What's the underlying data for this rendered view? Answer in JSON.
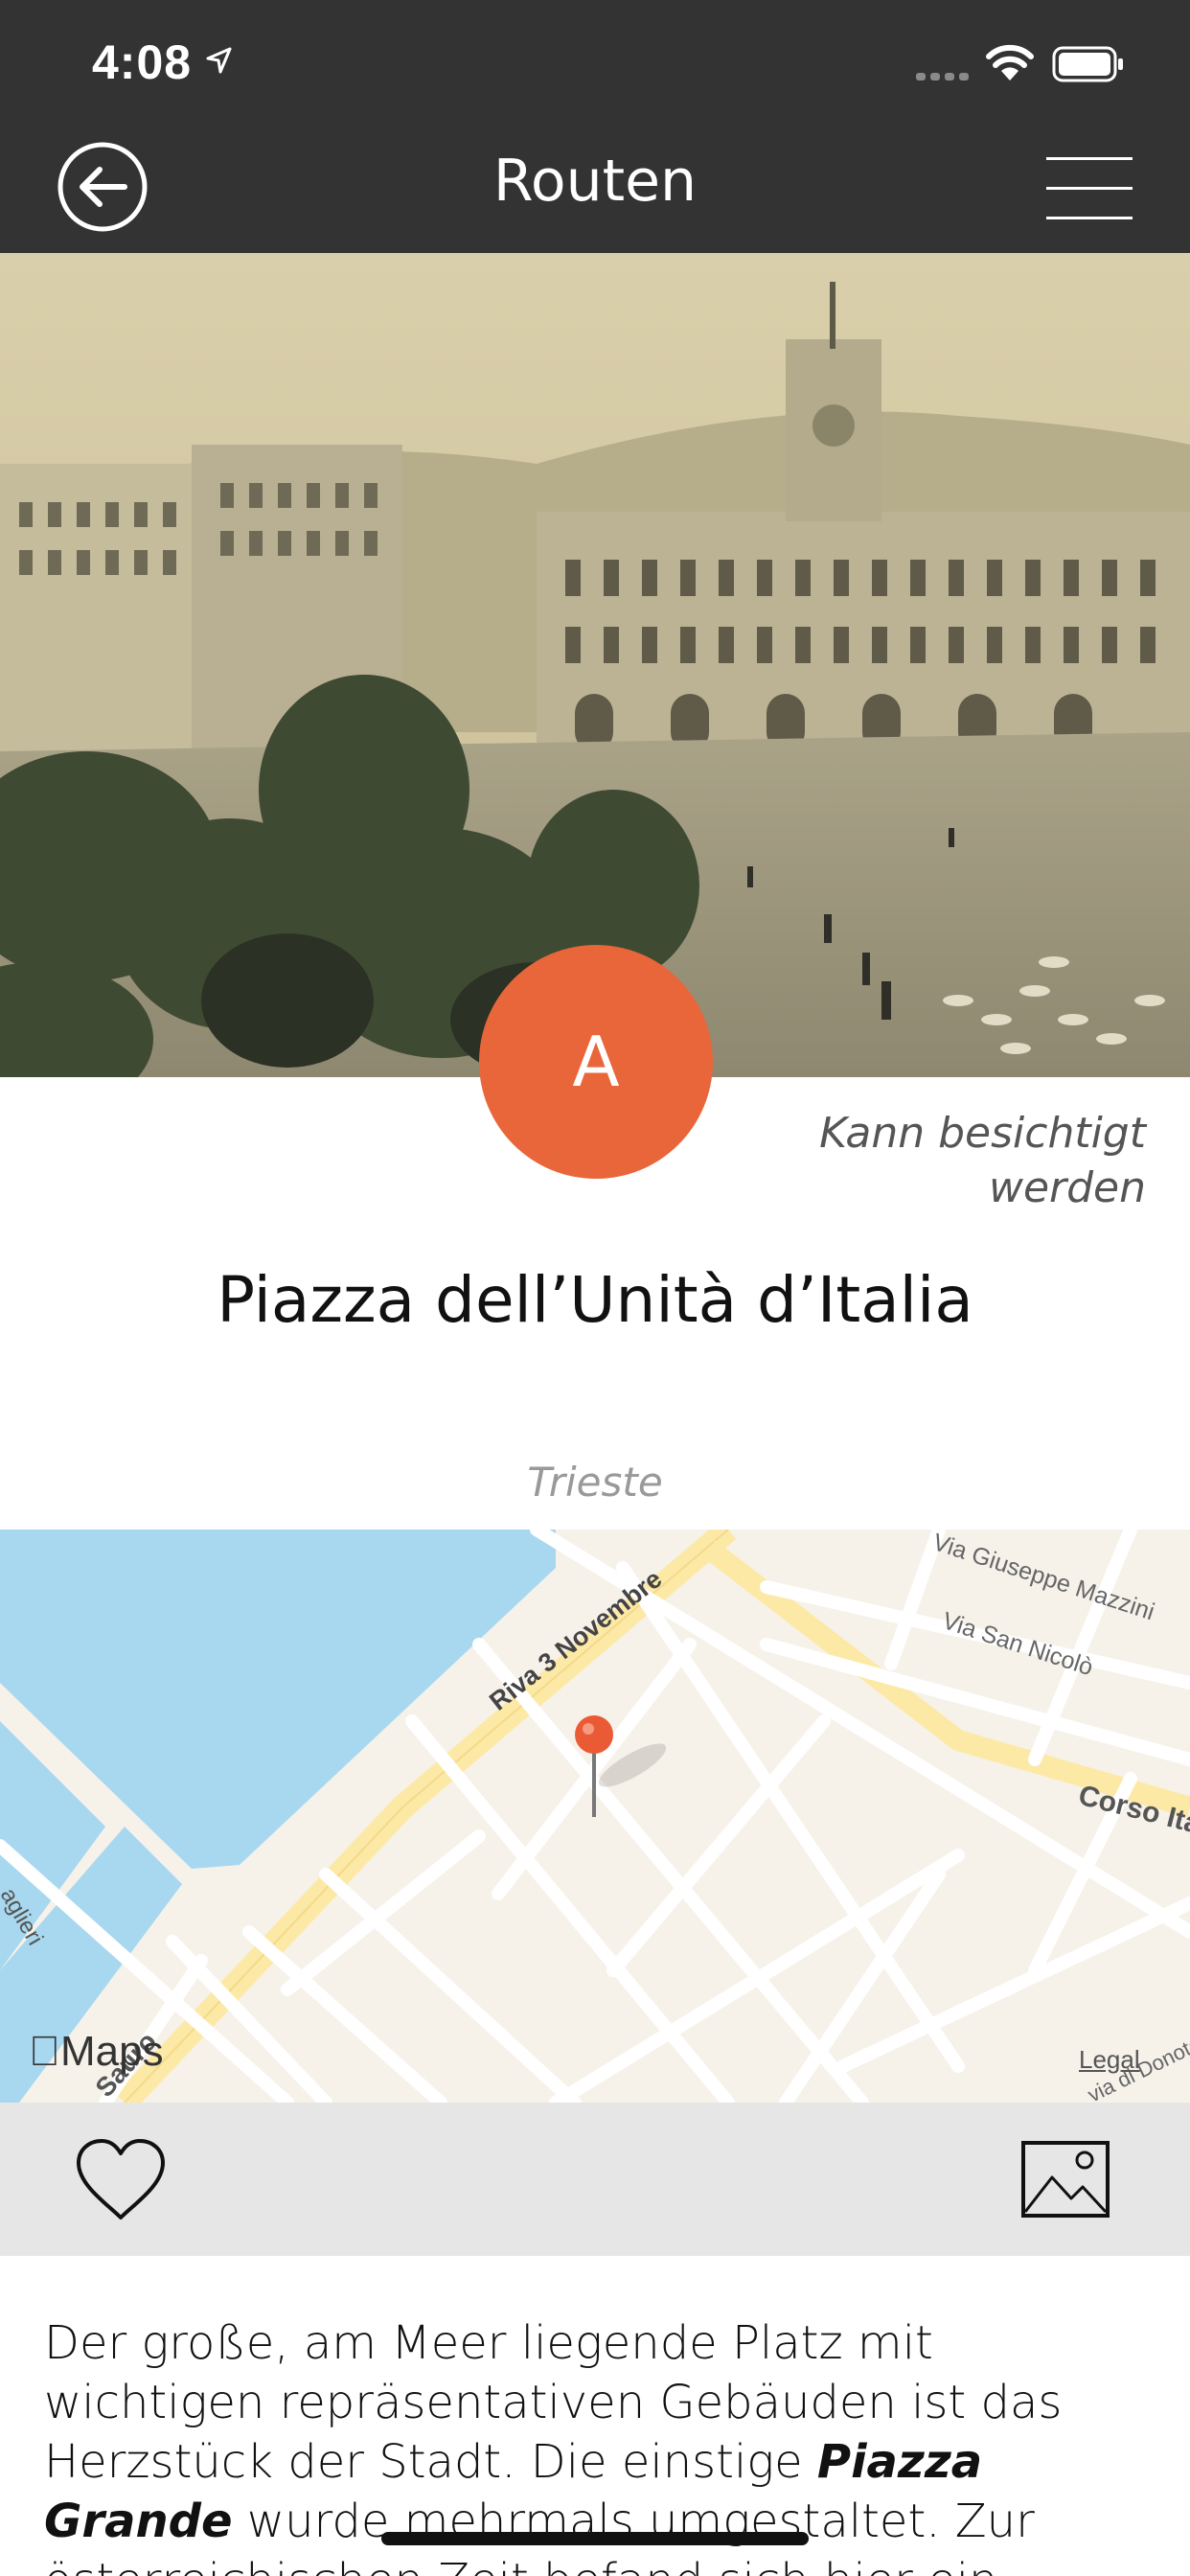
{
  "status_bar": {
    "time": "4:08"
  },
  "nav": {
    "title": "Routen"
  },
  "marker": {
    "letter": "A",
    "color": "#e9663b"
  },
  "place": {
    "visit_status_line1": "Kann besichtigt",
    "visit_status_line2": "werden",
    "title": "Piazza dell’Unità d’Italia",
    "city": "Trieste"
  },
  "map": {
    "brand": "Maps",
    "legal": "Legal",
    "streets": {
      "riva": "Riva 3 Novembre",
      "mazzini": "Via Giuseppe Mazzini",
      "san_nicolo": "Via San Nicolò",
      "corso": "Corso Ita",
      "left": "aglieri",
      "bottom_left": "Sauro",
      "bottom_right": "via di Donota"
    }
  },
  "description": {
    "part1": "Der große, am Meer liegende Platz mit wichtigen repräsentativen Gebäuden ist das Herzstück der Stadt. Die einstige ",
    "emphasis": "Piazza Grande",
    "part2": " wurde mehrmals umgestaltet. Zur österreichischen Zeit befand sich hier ein wichtiges kaiserliches Postgebäude"
  },
  "colors": {
    "header_bg": "#333333",
    "accent": "#e9663b",
    "action_bar_bg": "#e6e6e6",
    "water": "#a8d8ef"
  },
  "icons": {
    "back": "back-arrow-circle-icon",
    "menu": "hamburger-menu-icon",
    "favorite": "heart-outline-icon",
    "gallery": "image-gallery-icon"
  }
}
